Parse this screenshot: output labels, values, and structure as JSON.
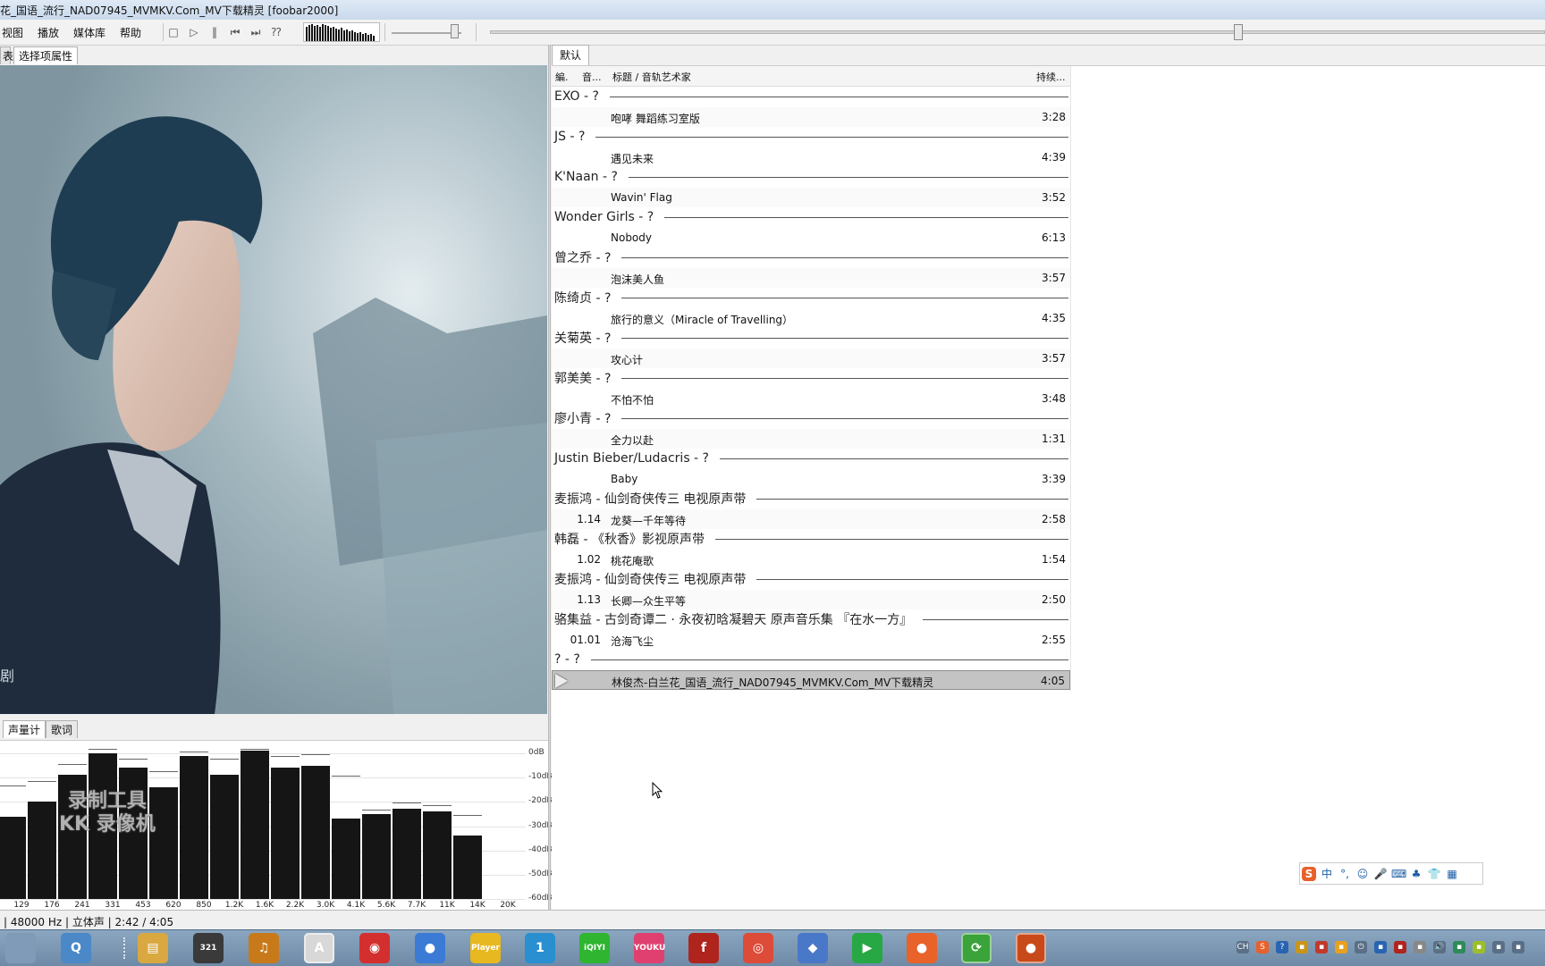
{
  "window": {
    "title": "花_国语_流行_NAD07945_MVMKV.Com_MV下载精灵  [foobar2000]"
  },
  "menu": {
    "items": [
      "视图",
      "播放",
      "媒体库",
      "帮助"
    ]
  },
  "left_tabs": {
    "top": [
      "表",
      "选择项属性"
    ],
    "bottom": [
      "声量计",
      "歌词"
    ]
  },
  "album_art": {
    "watermark": "剧"
  },
  "spectrum": {
    "db_labels": [
      "0dB",
      "-10dB",
      "-20dB",
      "-30dB",
      "-40dB",
      "-50dB",
      "-60dB"
    ],
    "freq_labels": [
      "129",
      "176",
      "241",
      "331",
      "453",
      "620",
      "850",
      "1.2K",
      "1.6K",
      "2.2K",
      "3.0K",
      "4.1K",
      "5.6K",
      "7.7K",
      "11K",
      "14K",
      "20K"
    ],
    "levels_db": [
      -26,
      -20,
      -9,
      0,
      -6,
      -14,
      -1,
      -9,
      1,
      -6,
      -5,
      -27,
      -25,
      -23,
      -24,
      -34
    ],
    "peaks_db": [
      -14,
      -12,
      -5,
      1,
      -3,
      -8,
      0,
      -3,
      1,
      -2,
      -1,
      -10,
      -24,
      -21,
      -22,
      -26
    ],
    "watermark_line1": "录制工具",
    "watermark_line2": "KK 录像机"
  },
  "playlist": {
    "tab": "默认",
    "headers": {
      "col1": "編.",
      "col2": "音...",
      "title": "标题 / 音轨艺术家",
      "duration": "持续..."
    },
    "groups": [
      {
        "label": "EXO - ?",
        "num": "",
        "title": "咆哮 舞蹈练习室版",
        "dur": "3:28"
      },
      {
        "label": "JS - ?",
        "num": "",
        "title": "遇见未来",
        "dur": "4:39"
      },
      {
        "label": "K'Naan - ?",
        "num": "",
        "title": "Wavin' Flag",
        "dur": "3:52"
      },
      {
        "label": "Wonder Girls - ?",
        "num": "",
        "title": "Nobody",
        "dur": "6:13"
      },
      {
        "label": "曾之乔 - ?",
        "num": "",
        "title": "泡沫美人鱼",
        "dur": "3:57"
      },
      {
        "label": "陈绮贞 - ?",
        "num": "",
        "title": "旅行的意义（Miracle of Travelling）",
        "dur": "4:35"
      },
      {
        "label": "关菊英 - ?",
        "num": "",
        "title": "攻心计",
        "dur": "3:57"
      },
      {
        "label": "郭美美 - ?",
        "num": "",
        "title": "不怕不怕",
        "dur": "3:48"
      },
      {
        "label": "廖小青 - ?",
        "num": "",
        "title": "全力以赴",
        "dur": "1:31"
      },
      {
        "label": "Justin Bieber/Ludacris - ?",
        "num": "",
        "title": "Baby",
        "dur": "3:39"
      },
      {
        "label": "麦振鸿 - 仙剑奇侠传三 电视原声带",
        "num": "1.14",
        "title": "龙葵—千年等待",
        "dur": "2:58"
      },
      {
        "label": "韩磊 - 《秋香》影视原声带",
        "num": "1.02",
        "title": "桃花庵歌",
        "dur": "1:54"
      },
      {
        "label": "麦振鸿 - 仙剑奇侠传三 电视原声带",
        "num": "1.13",
        "title": "长卿—众生平等",
        "dur": "2:50"
      },
      {
        "label": "骆集益 - 古剑奇谭二 · 永夜初晗凝碧天 原声音乐集 『在水一方』",
        "num": "01.01",
        "title": "沧海飞尘",
        "dur": "2:55"
      },
      {
        "label": "? - ?",
        "num": "",
        "title": "林俊杰-白兰花_国语_流行_NAD07945_MVMKV.Com_MV下载精灵",
        "dur": "4:05"
      }
    ]
  },
  "status": {
    "text": "| 48000 Hz | 立体声 | 2:42 / 4:05"
  },
  "ime": {
    "items": [
      "S",
      "中",
      "°,",
      "☺",
      "🎤",
      "⌨",
      "♣",
      "👕",
      "▦"
    ]
  },
  "taskbar": {
    "apps": [
      {
        "name": "start-grip",
        "label": "",
        "color": "#7f9bb8"
      },
      {
        "name": "search",
        "label": "Q",
        "color": "#4a88c8"
      },
      {
        "name": "grip2",
        "label": "",
        "color": "#7f9bb8"
      },
      {
        "name": "files",
        "label": "▤",
        "color": "#d9a840"
      },
      {
        "name": "321",
        "label": "321",
        "color": "#3a3a3a"
      },
      {
        "name": "headphones",
        "label": "♫",
        "color": "#c87a1a"
      },
      {
        "name": "foobar",
        "label": "A",
        "color": "#d8d8d8"
      },
      {
        "name": "netease",
        "label": "◉",
        "color": "#d32f2f"
      },
      {
        "name": "media",
        "label": "●",
        "color": "#3b7bd6"
      },
      {
        "name": "player",
        "label": "Player",
        "color": "#e8b820"
      },
      {
        "name": "one",
        "label": "1",
        "color": "#2a8fd0"
      },
      {
        "name": "iqiyi",
        "label": "iQIYI",
        "color": "#2fb52f"
      },
      {
        "name": "youku",
        "label": "YOUKU",
        "color": "#e04070"
      },
      {
        "name": "flash",
        "label": "f",
        "color": "#b0241e"
      },
      {
        "name": "chrome",
        "label": "◎",
        "color": "#dd4b39"
      },
      {
        "name": "app-bird",
        "label": "◆",
        "color": "#4a78c8"
      },
      {
        "name": "play",
        "label": "▶",
        "color": "#28a745"
      },
      {
        "name": "firefox",
        "label": "●",
        "color": "#e8622a"
      },
      {
        "name": "green-app",
        "label": "⟳",
        "color": "#3aa33a"
      },
      {
        "name": "kk-recorder",
        "label": "●",
        "color": "#c84a1a"
      }
    ],
    "tray": [
      "CH",
      "S",
      "?",
      "▪",
      "▪",
      "▪",
      "⏻",
      "▪",
      "▪",
      "▪",
      "🔊",
      "▪",
      "▪",
      "▪",
      "▪"
    ]
  },
  "colors": {
    "accent": "#4f6a86",
    "playing_row": "#c3c3c3",
    "spectrum_bar": "#151515"
  }
}
